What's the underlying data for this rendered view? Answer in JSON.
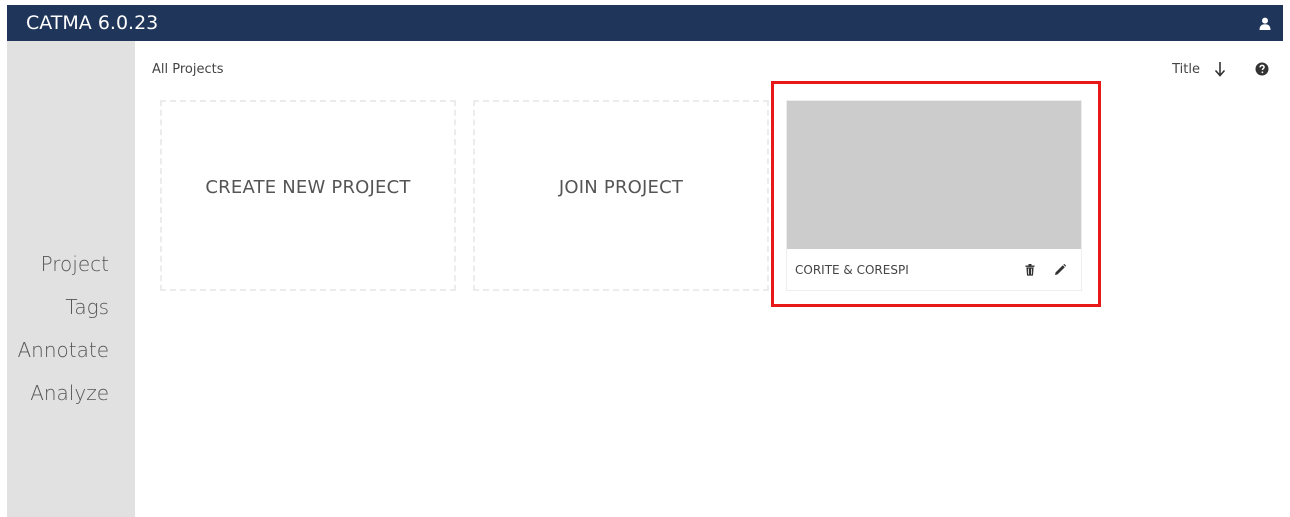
{
  "app": {
    "title": "CATMA 6.0.23"
  },
  "header": {
    "user_icon": "user-icon"
  },
  "sidebar": {
    "items": [
      {
        "label": "Project"
      },
      {
        "label": "Tags"
      },
      {
        "label": "Annotate"
      },
      {
        "label": "Analyze"
      }
    ]
  },
  "main": {
    "breadcrumb": "All Projects",
    "sort": {
      "label": "Title",
      "direction_icon": "arrow-down-icon",
      "help_icon": "help-icon"
    },
    "tiles": {
      "create": "CREATE NEW PROJECT",
      "join": "JOIN PROJECT"
    },
    "projects": [
      {
        "name": "CORITE & CORESPI",
        "delete_icon": "trash-icon",
        "edit_icon": "pencil-icon"
      }
    ]
  },
  "colors": {
    "header_bg": "#1f3559",
    "sidebar_bg": "#e1e1e1",
    "thumbnail_bg": "#cccccc",
    "highlight": "#e81818"
  }
}
